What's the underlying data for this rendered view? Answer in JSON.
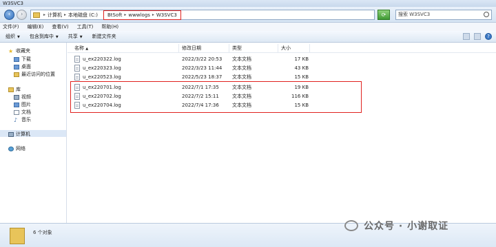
{
  "window": {
    "title": "W3SVC3"
  },
  "address": {
    "crumbs": [
      "计算机",
      "本地磁盘 (C:)"
    ],
    "highlighted_crumbs": [
      "BtSoft",
      "wwwlogs",
      "W3SVC3"
    ],
    "search_placeholder": "搜索 W3SVC3"
  },
  "menu": [
    "文件(F)",
    "编辑(E)",
    "查看(V)",
    "工具(T)",
    "帮助(H)"
  ],
  "toolbar": {
    "organize": "组织",
    "include_library": "包含到库中",
    "share": "共享",
    "new_folder": "新建文件夹"
  },
  "sidebar": {
    "favorites": "收藏夹",
    "downloads": "下载",
    "desktop": "桌面",
    "recent": "最近访问的位置",
    "libraries": "库",
    "videos": "视频",
    "pictures": "图片",
    "documents": "文档",
    "music": "音乐",
    "computer": "计算机",
    "network": "网络"
  },
  "columns": {
    "name": "名称",
    "modified": "修改日期",
    "type": "类型",
    "size": "大小"
  },
  "files": [
    {
      "name": "u_ex220322.log",
      "modified": "2022/3/22 20:53",
      "type": "文本文档",
      "size": "17 KB"
    },
    {
      "name": "u_ex220323.log",
      "modified": "2022/3/23 11:44",
      "type": "文本文档",
      "size": "43 KB"
    },
    {
      "name": "u_ex220523.log",
      "modified": "2022/5/23 18:37",
      "type": "文本文档",
      "size": "15 KB"
    },
    {
      "name": "u_ex220701.log",
      "modified": "2022/7/1 17:35",
      "type": "文本文档",
      "size": "19 KB"
    },
    {
      "name": "u_ex220702.log",
      "modified": "2022/7/2 15:11",
      "type": "文本文档",
      "size": "116 KB"
    },
    {
      "name": "u_ex220704.log",
      "modified": "2022/7/4 17:36",
      "type": "文本文档",
      "size": "15 KB"
    }
  ],
  "status": {
    "count": "6 个对象"
  },
  "watermark": "公众号 · 小谢取证",
  "colors": {
    "highlight_red": "#e0201d",
    "selection": "#dbe7f6",
    "folder": "#e8c45a"
  }
}
